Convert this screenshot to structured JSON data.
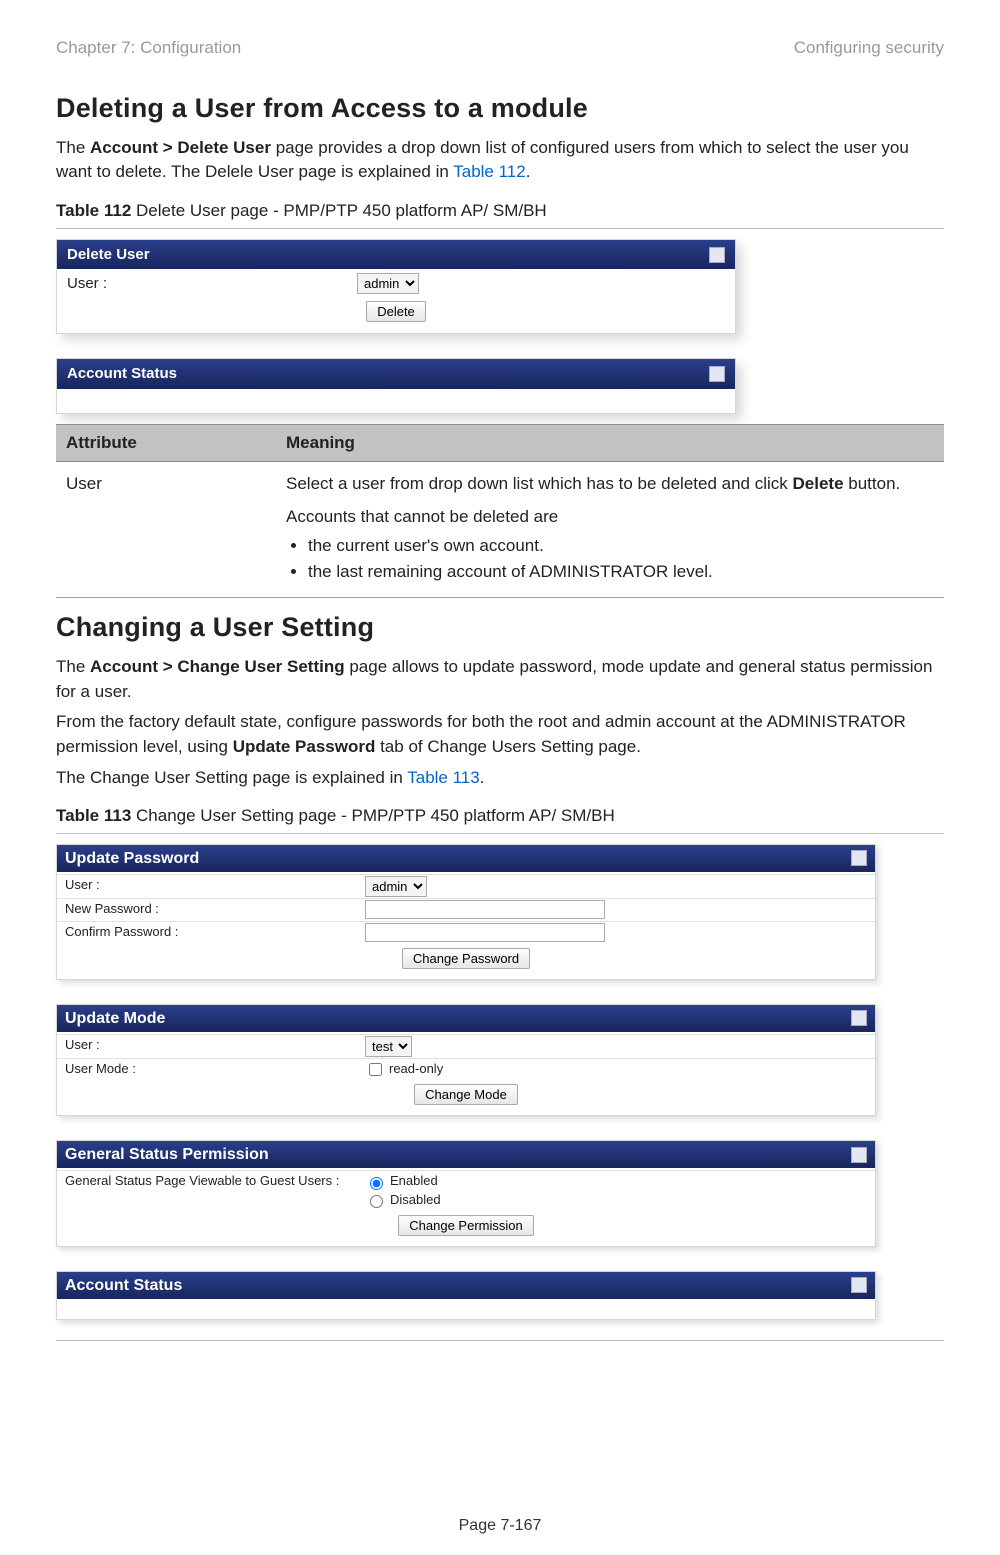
{
  "header": {
    "left": "Chapter 7:  Configuration",
    "right": "Configuring security"
  },
  "section1": {
    "title": "Deleting a User from Access to a module",
    "intro_pre": "The ",
    "intro_strong": "Account > Delete User",
    "intro_post": " page provides a drop down list of configured users from which to select the user you want to delete. The Delele User page is explained in ",
    "intro_link": "Table 112",
    "intro_dot": "."
  },
  "table112": {
    "caption_strong": "Table 112",
    "caption_rest": " Delete User page - PMP/PTP 450 platform AP/ SM/BH"
  },
  "panel_delete_user": {
    "title": "Delete User",
    "user_label": "User :",
    "user_value": "admin",
    "delete_btn": "Delete"
  },
  "panel_account_status": {
    "title": "Account Status"
  },
  "def_table": {
    "col1": "Attribute",
    "col2": "Meaning",
    "row_user_attr": "User",
    "row_user_meaning_1a": "Select a user from drop down list which has to be deleted and click ",
    "row_user_meaning_1b": "Delete",
    "row_user_meaning_1c": " button.",
    "row_user_meaning_2": "Accounts that cannot be deleted are",
    "row_user_bullet1": "the current user's own account.",
    "row_user_bullet2": "the last remaining account of ADMINISTRATOR level."
  },
  "section2": {
    "title": "Changing a User Setting",
    "p1_pre": "The ",
    "p1_strong": "Account > Change User Setting",
    "p1_post": " page allows to update password, mode update and general status permission for a user.",
    "p2_pre": "From the factory default state, configure passwords for both the root and admin account at the ADMINISTRATOR permission level, using ",
    "p2_strong": "Update Password",
    "p2_post": " tab of Change Users Setting page.",
    "p3_pre": "The Change User Setting page is explained in ",
    "p3_link": "Table 113",
    "p3_dot": "."
  },
  "table113": {
    "caption_strong": "Table 113",
    "caption_rest": " Change User Setting page - PMP/PTP 450 platform AP/ SM/BH"
  },
  "panel_update_password": {
    "title": "Update Password",
    "user_label": "User :",
    "user_value": "admin",
    "newpw_label": "New Password :",
    "confpw_label": "Confirm Password :",
    "btn": "Change Password"
  },
  "panel_update_mode": {
    "title": "Update Mode",
    "user_label": "User :",
    "user_value": "test",
    "mode_label": "User Mode :",
    "mode_option": "read-only",
    "btn": "Change Mode"
  },
  "panel_general_status": {
    "title": "General Status Permission",
    "row_label": "General Status Page Viewable to Guest Users :",
    "opt_enabled": "Enabled",
    "opt_disabled": "Disabled",
    "btn": "Change Permission"
  },
  "panel_account_status2": {
    "title": "Account Status"
  },
  "footer": {
    "page_number": "Page 7-167"
  }
}
